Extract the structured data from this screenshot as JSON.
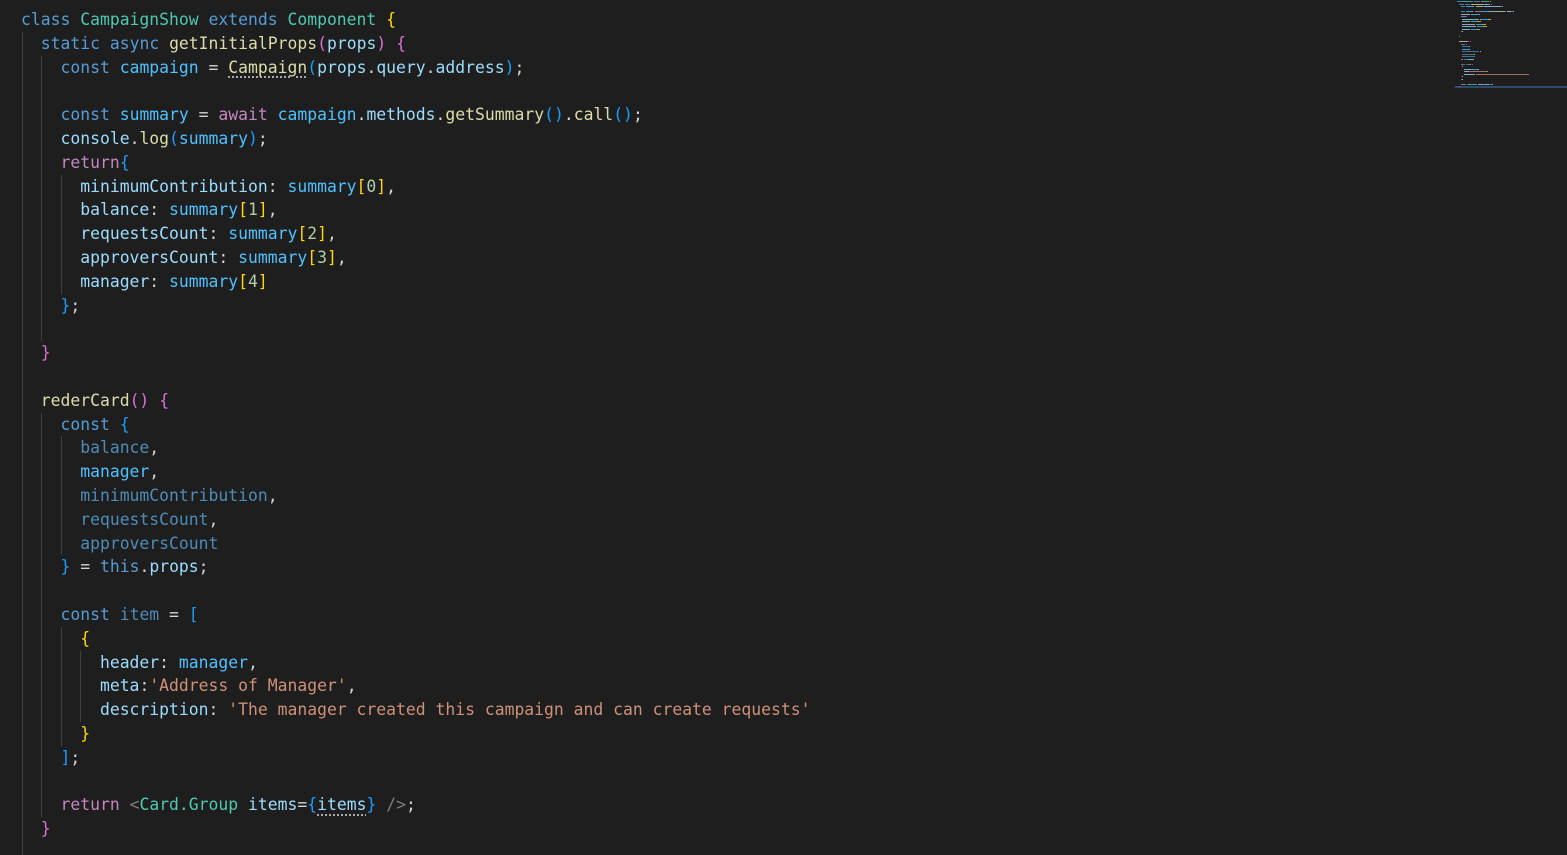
{
  "colors": {
    "background": "#1e1e1e",
    "text": "#d4d4d4",
    "keyword": "#569cd6",
    "control": "#c586c0",
    "class_name": "#4ec9b0",
    "function": "#dcdcaa",
    "variable": "#9cdcfe",
    "constant": "#4fc1ff",
    "string": "#ce9178",
    "number": "#b5cea8",
    "faded": "#4d8cb8",
    "bracket_gold": "#ffd700",
    "bracket_pink": "#da70d6",
    "bracket_blue": "#179fff",
    "tag": "#808080",
    "indent_guide": "#404040"
  },
  "editor": {
    "lines": [
      {
        "indent": 0,
        "tokens": [
          {
            "t": "class ",
            "c": "keyword"
          },
          {
            "t": "CampaignShow",
            "c": "class_name"
          },
          {
            "t": " ",
            "c": "text"
          },
          {
            "t": "extends",
            "c": "keyword"
          },
          {
            "t": " ",
            "c": "text"
          },
          {
            "t": "Component",
            "c": "class_name"
          },
          {
            "t": " ",
            "c": "text"
          },
          {
            "t": "{",
            "c": "bracket_gold"
          }
        ]
      },
      {
        "indent": 1,
        "tokens": [
          {
            "t": "static",
            "c": "keyword"
          },
          {
            "t": " ",
            "c": "text"
          },
          {
            "t": "async",
            "c": "keyword"
          },
          {
            "t": " ",
            "c": "text"
          },
          {
            "t": "getInitialProps",
            "c": "function"
          },
          {
            "t": "(",
            "c": "bracket_pink"
          },
          {
            "t": "props",
            "c": "variable"
          },
          {
            "t": ")",
            "c": "bracket_pink"
          },
          {
            "t": " ",
            "c": "text"
          },
          {
            "t": "{",
            "c": "bracket_pink"
          }
        ]
      },
      {
        "indent": 2,
        "tokens": [
          {
            "t": "const",
            "c": "keyword"
          },
          {
            "t": " ",
            "c": "text"
          },
          {
            "t": "campaign",
            "c": "constant"
          },
          {
            "t": " = ",
            "c": "text"
          },
          {
            "t": "Campaign",
            "c": "function",
            "squiggle": true
          },
          {
            "t": "(",
            "c": "bracket_blue"
          },
          {
            "t": "props",
            "c": "variable"
          },
          {
            "t": ".",
            "c": "text"
          },
          {
            "t": "query",
            "c": "variable"
          },
          {
            "t": ".",
            "c": "text"
          },
          {
            "t": "address",
            "c": "variable"
          },
          {
            "t": ")",
            "c": "bracket_blue"
          },
          {
            "t": ";",
            "c": "text"
          }
        ]
      },
      {
        "indent": 2,
        "tokens": []
      },
      {
        "indent": 2,
        "tokens": [
          {
            "t": "const",
            "c": "keyword"
          },
          {
            "t": " ",
            "c": "text"
          },
          {
            "t": "summary",
            "c": "constant"
          },
          {
            "t": " = ",
            "c": "text"
          },
          {
            "t": "await",
            "c": "control"
          },
          {
            "t": " ",
            "c": "text"
          },
          {
            "t": "campaign",
            "c": "constant"
          },
          {
            "t": ".",
            "c": "text"
          },
          {
            "t": "methods",
            "c": "variable"
          },
          {
            "t": ".",
            "c": "text"
          },
          {
            "t": "getSummary",
            "c": "function"
          },
          {
            "t": "()",
            "c": "bracket_blue"
          },
          {
            "t": ".",
            "c": "text"
          },
          {
            "t": "call",
            "c": "function"
          },
          {
            "t": "()",
            "c": "bracket_blue"
          },
          {
            "t": ";",
            "c": "text"
          }
        ]
      },
      {
        "indent": 2,
        "tokens": [
          {
            "t": "console",
            "c": "variable"
          },
          {
            "t": ".",
            "c": "text"
          },
          {
            "t": "log",
            "c": "function"
          },
          {
            "t": "(",
            "c": "bracket_blue"
          },
          {
            "t": "summary",
            "c": "constant"
          },
          {
            "t": ")",
            "c": "bracket_blue"
          },
          {
            "t": ";",
            "c": "text"
          }
        ]
      },
      {
        "indent": 2,
        "tokens": [
          {
            "t": "return",
            "c": "control"
          },
          {
            "t": "{",
            "c": "bracket_blue"
          }
        ]
      },
      {
        "indent": 3,
        "tokens": [
          {
            "t": "minimumContribution",
            "c": "variable"
          },
          {
            "t": ": ",
            "c": "text"
          },
          {
            "t": "summary",
            "c": "constant"
          },
          {
            "t": "[",
            "c": "bracket_gold"
          },
          {
            "t": "0",
            "c": "number"
          },
          {
            "t": "]",
            "c": "bracket_gold"
          },
          {
            "t": ",",
            "c": "text"
          }
        ]
      },
      {
        "indent": 3,
        "tokens": [
          {
            "t": "balance",
            "c": "variable"
          },
          {
            "t": ": ",
            "c": "text"
          },
          {
            "t": "summary",
            "c": "constant"
          },
          {
            "t": "[",
            "c": "bracket_gold"
          },
          {
            "t": "1",
            "c": "number"
          },
          {
            "t": "]",
            "c": "bracket_gold"
          },
          {
            "t": ",",
            "c": "text"
          }
        ]
      },
      {
        "indent": 3,
        "tokens": [
          {
            "t": "requestsCount",
            "c": "variable"
          },
          {
            "t": ": ",
            "c": "text"
          },
          {
            "t": "summary",
            "c": "constant"
          },
          {
            "t": "[",
            "c": "bracket_gold"
          },
          {
            "t": "2",
            "c": "number"
          },
          {
            "t": "]",
            "c": "bracket_gold"
          },
          {
            "t": ",",
            "c": "text"
          }
        ]
      },
      {
        "indent": 3,
        "tokens": [
          {
            "t": "approversCount",
            "c": "variable"
          },
          {
            "t": ": ",
            "c": "text"
          },
          {
            "t": "summary",
            "c": "constant"
          },
          {
            "t": "[",
            "c": "bracket_gold"
          },
          {
            "t": "3",
            "c": "number"
          },
          {
            "t": "]",
            "c": "bracket_gold"
          },
          {
            "t": ",",
            "c": "text"
          }
        ]
      },
      {
        "indent": 3,
        "tokens": [
          {
            "t": "manager",
            "c": "variable"
          },
          {
            "t": ": ",
            "c": "text"
          },
          {
            "t": "summary",
            "c": "constant"
          },
          {
            "t": "[",
            "c": "bracket_gold"
          },
          {
            "t": "4",
            "c": "number"
          },
          {
            "t": "]",
            "c": "bracket_gold"
          }
        ]
      },
      {
        "indent": 2,
        "tokens": [
          {
            "t": "}",
            "c": "bracket_blue"
          },
          {
            "t": ";",
            "c": "text"
          }
        ]
      },
      {
        "indent": 2,
        "tokens": []
      },
      {
        "indent": 1,
        "tokens": [
          {
            "t": "}",
            "c": "bracket_pink"
          }
        ]
      },
      {
        "indent": 1,
        "tokens": []
      },
      {
        "indent": 1,
        "tokens": [
          {
            "t": "rederCard",
            "c": "function"
          },
          {
            "t": "()",
            "c": "bracket_pink"
          },
          {
            "t": " ",
            "c": "text"
          },
          {
            "t": "{",
            "c": "bracket_pink"
          }
        ]
      },
      {
        "indent": 2,
        "tokens": [
          {
            "t": "const",
            "c": "keyword"
          },
          {
            "t": " ",
            "c": "text"
          },
          {
            "t": "{",
            "c": "bracket_blue"
          }
        ]
      },
      {
        "indent": 3,
        "tokens": [
          {
            "t": "balance",
            "c": "faded"
          },
          {
            "t": ",",
            "c": "text"
          }
        ]
      },
      {
        "indent": 3,
        "tokens": [
          {
            "t": "manager",
            "c": "constant"
          },
          {
            "t": ",",
            "c": "text"
          }
        ]
      },
      {
        "indent": 3,
        "tokens": [
          {
            "t": "minimumContribution",
            "c": "faded"
          },
          {
            "t": ",",
            "c": "text"
          }
        ]
      },
      {
        "indent": 3,
        "tokens": [
          {
            "t": "requestsCount",
            "c": "faded"
          },
          {
            "t": ",",
            "c": "text"
          }
        ]
      },
      {
        "indent": 3,
        "tokens": [
          {
            "t": "approversCount",
            "c": "faded"
          }
        ]
      },
      {
        "indent": 2,
        "tokens": [
          {
            "t": "}",
            "c": "bracket_blue"
          },
          {
            "t": " = ",
            "c": "text"
          },
          {
            "t": "this",
            "c": "keyword"
          },
          {
            "t": ".",
            "c": "text"
          },
          {
            "t": "props",
            "c": "variable"
          },
          {
            "t": ";",
            "c": "text"
          }
        ]
      },
      {
        "indent": 2,
        "tokens": []
      },
      {
        "indent": 2,
        "tokens": [
          {
            "t": "const",
            "c": "keyword"
          },
          {
            "t": " ",
            "c": "text"
          },
          {
            "t": "item",
            "c": "faded"
          },
          {
            "t": " = ",
            "c": "text"
          },
          {
            "t": "[",
            "c": "bracket_blue"
          }
        ]
      },
      {
        "indent": 3,
        "tokens": [
          {
            "t": "{",
            "c": "bracket_gold"
          }
        ]
      },
      {
        "indent": 4,
        "tokens": [
          {
            "t": "header",
            "c": "variable"
          },
          {
            "t": ": ",
            "c": "text"
          },
          {
            "t": "manager",
            "c": "constant"
          },
          {
            "t": ",",
            "c": "text"
          }
        ]
      },
      {
        "indent": 4,
        "tokens": [
          {
            "t": "meta",
            "c": "variable"
          },
          {
            "t": ":",
            "c": "text"
          },
          {
            "t": "'Address of Manager'",
            "c": "string"
          },
          {
            "t": ",",
            "c": "text"
          }
        ]
      },
      {
        "indent": 4,
        "tokens": [
          {
            "t": "description",
            "c": "variable"
          },
          {
            "t": ": ",
            "c": "text"
          },
          {
            "t": "'The manager created this campaign and can create requests'",
            "c": "string"
          }
        ]
      },
      {
        "indent": 3,
        "tokens": [
          {
            "t": "}",
            "c": "bracket_gold"
          }
        ]
      },
      {
        "indent": 2,
        "tokens": [
          {
            "t": "]",
            "c": "bracket_blue"
          },
          {
            "t": ";",
            "c": "text"
          }
        ]
      },
      {
        "indent": 2,
        "tokens": []
      },
      {
        "indent": 2,
        "tokens": [
          {
            "t": "return",
            "c": "control"
          },
          {
            "t": " ",
            "c": "text"
          },
          {
            "t": "<",
            "c": "tag"
          },
          {
            "t": "Card.Group",
            "c": "class_name"
          },
          {
            "t": " ",
            "c": "text"
          },
          {
            "t": "items",
            "c": "variable"
          },
          {
            "t": "=",
            "c": "text"
          },
          {
            "t": "{",
            "c": "bracket_blue"
          },
          {
            "t": "items",
            "c": "variable",
            "squiggle": true
          },
          {
            "t": "}",
            "c": "bracket_blue"
          },
          {
            "t": " ",
            "c": "text"
          },
          {
            "t": "/>",
            "c": "tag"
          },
          {
            "t": ";",
            "c": "text"
          }
        ]
      },
      {
        "indent": 1,
        "tokens": [
          {
            "t": "}",
            "c": "bracket_pink"
          }
        ]
      },
      {
        "indent": 1,
        "tokens": []
      }
    ]
  }
}
